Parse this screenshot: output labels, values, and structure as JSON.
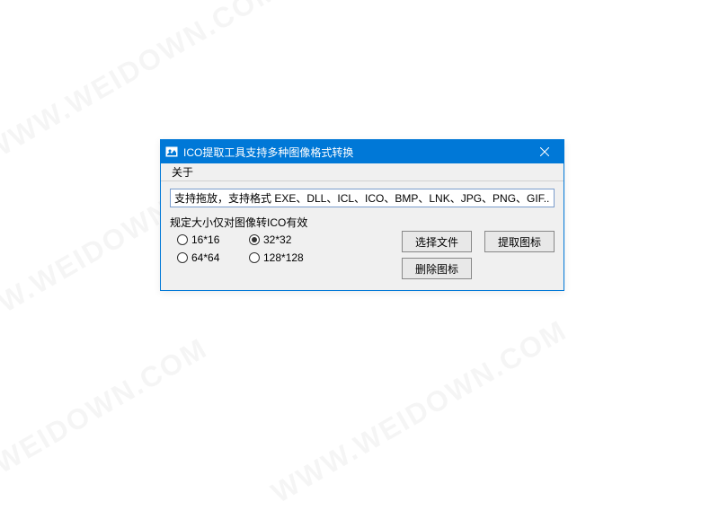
{
  "watermark": "WWW.WEIDOWN.COM",
  "window": {
    "title": "ICO提取工具支持多种图像格式转换"
  },
  "menu": {
    "about": "关于"
  },
  "hint": {
    "value": "支持拖放，支持格式 EXE、DLL、ICL、ICO、BMP、LNK、JPG、PNG、GIF..."
  },
  "sizeGroup": {
    "label": "规定大小仅对图像转ICO有效",
    "options": {
      "s16": "16*16",
      "s32": "32*32",
      "s64": "64*64",
      "s128": "128*128"
    },
    "selected": "s32"
  },
  "buttons": {
    "selectFile": "选择文件",
    "extractIcon": "提取图标",
    "deleteIcon": "删除图标"
  }
}
